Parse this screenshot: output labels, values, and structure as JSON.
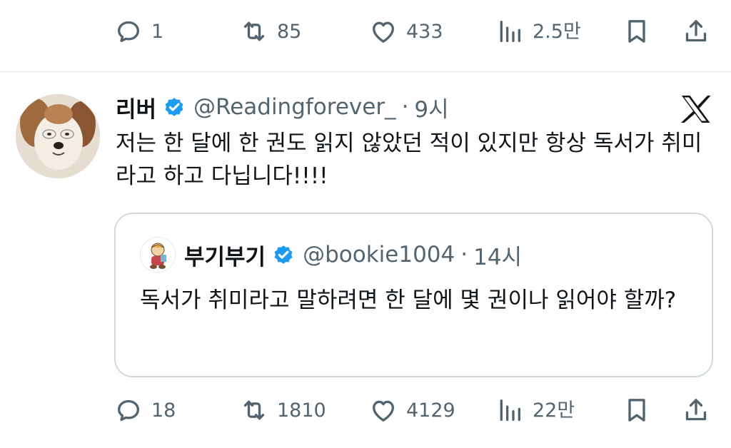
{
  "top_actions": {
    "replies": "1",
    "reposts": "85",
    "likes": "433",
    "views": "2.5만"
  },
  "tweet": {
    "author_name": "리버",
    "author_handle": "@Readingforever_",
    "separator": "·",
    "time": "9시",
    "text": "저는 한 달에 한 권도 읽지 않았던 적이 있지만 항상 독서가 취미라고 하고 다닙니다!!!!"
  },
  "quote": {
    "author_name": "부기부기",
    "author_handle": "@bookie1004",
    "separator": "·",
    "time": "14시",
    "text": "독서가 취미라고 말하려면 한 달에 몇 권이나 읽어야 할까?"
  },
  "bottom_actions": {
    "replies": "18",
    "reposts": "1810",
    "likes": "4129",
    "views": "22만"
  },
  "colors": {
    "text_primary": "#0f1419",
    "text_secondary": "#536471",
    "verified_blue": "#1d9bf0",
    "border": "#cfd9de"
  },
  "icons": [
    "reply-icon",
    "repost-icon",
    "like-icon",
    "views-icon",
    "bookmark-icon",
    "share-icon",
    "verified-badge-icon",
    "x-logo-icon"
  ]
}
